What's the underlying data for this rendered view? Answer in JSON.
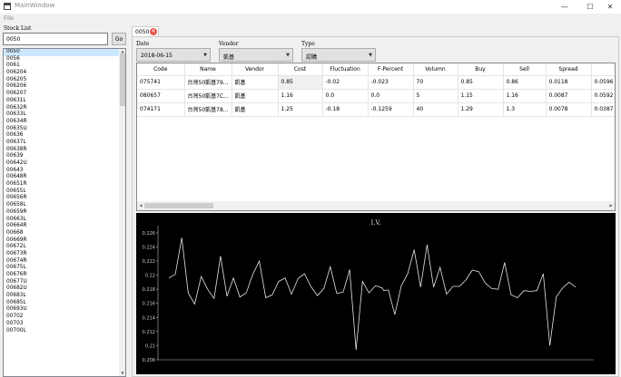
{
  "window": {
    "title": "MainWindow",
    "minimize": "—",
    "maximize": "☐",
    "close": "✕"
  },
  "menu": {
    "file": "File"
  },
  "left": {
    "label": "Stock List",
    "search_value": "0050",
    "go_label": "Go",
    "items": [
      "0050",
      "0056",
      "0061",
      "006204",
      "006205",
      "006206",
      "006207",
      "00631L",
      "00632R",
      "00633L",
      "00634R",
      "00635U",
      "00636",
      "00637L",
      "00638R",
      "00639",
      "00642U",
      "00643",
      "00648R",
      "00651R",
      "00655L",
      "00656R",
      "00658L",
      "00659R",
      "00663L",
      "00664R",
      "00668",
      "00669R",
      "00672L",
      "00673R",
      "00674R",
      "00675L",
      "00676R",
      "00677U",
      "00682U",
      "00683L",
      "00685L",
      "00693U",
      "00702",
      "00703",
      "00700L"
    ],
    "selected_index": 0
  },
  "tab": {
    "label": "0050",
    "close": "✕"
  },
  "filters": {
    "date_label": "Date",
    "date_value": "2018-06-15",
    "vendor_label": "Vendor",
    "vendor_value": "凱基",
    "type_label": "Type",
    "type_value": "認購",
    "arrow": "▼"
  },
  "table": {
    "columns": [
      "Code",
      "Name",
      "Vendor",
      "Cost",
      "Fluctuation",
      "F-Percent",
      "Volumn",
      "Buy",
      "Sell",
      "Spread",
      "Prem"
    ],
    "rows": [
      [
        "075741",
        "台灣50凱基79...",
        "凱基",
        "0.85",
        "-0.02",
        "-0.023",
        "70",
        "0.85",
        "0.86",
        "0.0118",
        "0.0596"
      ],
      [
        "080657",
        "台灣50凱基7C...",
        "凱基",
        "1.16",
        "0.0",
        "0.0",
        "5",
        "1.15",
        "1.16",
        "0.0087",
        "0.0592"
      ],
      [
        "074171",
        "台灣50凱基78...",
        "凱基",
        "1.25",
        "-0.18",
        "-0.1259",
        "40",
        "1.29",
        "1.3",
        "0.0078",
        "0.0387"
      ]
    ],
    "highlight": {
      "row": 0,
      "col": 3
    }
  },
  "chart_data": {
    "type": "line",
    "title": "I.V.",
    "ylim": [
      0.208,
      0.2265
    ],
    "yticks": [
      "0.226",
      "0.224",
      "0.222",
      "0.22",
      "0.218",
      "0.216",
      "0.214",
      "0.212",
      "0.21",
      "0.208"
    ],
    "yticks_values": [
      0.226,
      0.224,
      0.222,
      0.22,
      0.218,
      0.216,
      0.214,
      0.212,
      0.21,
      0.208
    ],
    "grid": false,
    "line_color": "#e6e6e6",
    "background": "#000000",
    "x": [
      0,
      1,
      2,
      3,
      4,
      5,
      6,
      7,
      8,
      9,
      10,
      11,
      12,
      13,
      14,
      15,
      16,
      17,
      18,
      19,
      20,
      21,
      22,
      23,
      24,
      25,
      26,
      27,
      28,
      29,
      30,
      31,
      32,
      33,
      33.3,
      34,
      35,
      36,
      37,
      38,
      39,
      40,
      41,
      42,
      43,
      44,
      45,
      46,
      47,
      48,
      49,
      50,
      51,
      52,
      53,
      54,
      55,
      56,
      57,
      58,
      59,
      60,
      61,
      62,
      63
    ],
    "series": [
      {
        "values": [
          0.2196,
          0.2201,
          0.2253,
          0.2175,
          0.2159,
          0.2198,
          0.218,
          0.2167,
          0.2227,
          0.217,
          0.2196,
          0.2169,
          0.2175,
          0.2201,
          0.222,
          0.2168,
          0.2172,
          0.2191,
          0.2196,
          0.2173,
          0.2195,
          0.2202,
          0.2184,
          0.2171,
          0.2181,
          0.2212,
          0.2174,
          0.2176,
          0.2208,
          0.2094,
          0.2191,
          0.2175,
          0.2185,
          0.2182,
          0.2178,
          0.2179,
          0.2144,
          0.2185,
          0.2202,
          0.2236,
          0.2183,
          0.2243,
          0.2183,
          0.2211,
          0.2173,
          0.2184,
          0.2184,
          0.2193,
          0.2207,
          0.2205,
          0.2189,
          0.2181,
          0.218,
          0.2218,
          0.2172,
          0.2168,
          0.2178,
          0.2177,
          0.2178,
          0.2202,
          0.21,
          0.2169,
          0.2182,
          0.219,
          0.2183
        ]
      }
    ]
  }
}
